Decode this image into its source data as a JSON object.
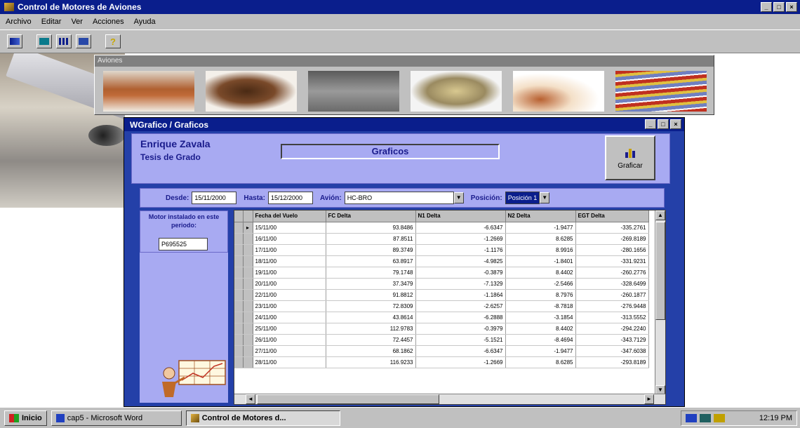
{
  "app": {
    "title": "Control de Motores de Aviones"
  },
  "menu": [
    "Archivo",
    "Editar",
    "Ver",
    "Acciones",
    "Ayuda"
  ],
  "aviones_panel": {
    "title": "Aviones"
  },
  "grafico_window": {
    "title": "WGrafico / Graficos",
    "author": "Enrique Zavala",
    "subtitle": "Tesis de Grado",
    "heading": "Graficos",
    "graficar_label": "Graficar"
  },
  "filters": {
    "desde_label": "Desde:",
    "desde_value": "15/11/2000",
    "hasta_label": "Hasta:",
    "hasta_value": "15/12/2000",
    "avion_label": "Avión:",
    "avion_value": "HC-BRO",
    "posicion_label": "Posición:",
    "posicion_value": "Posición 1"
  },
  "motor": {
    "label": "Motor instalado en este periodo:",
    "value": "P695525"
  },
  "table": {
    "columns": [
      "Fecha del Vuelo",
      "FC Delta",
      "N1 Delta",
      "N2 Delta",
      "EGT Delta"
    ],
    "rows": [
      [
        "15/11/00",
        "93.8486",
        "-6.6347",
        "-1.9477",
        "-335.2761"
      ],
      [
        "16/11/00",
        "87.8511",
        "-1.2669",
        "8.6285",
        "-269.8189"
      ],
      [
        "17/11/00",
        "89.3749",
        "-1.1176",
        "8.9916",
        "-280.1656"
      ],
      [
        "18/11/00",
        "63.8917",
        "-4.9825",
        "-1.8401",
        "-331.9231"
      ],
      [
        "19/11/00",
        "79.1748",
        "-0.3879",
        "8.4402",
        "-260.2776"
      ],
      [
        "20/11/00",
        "37.3479",
        "-7.1329",
        "-2.5466",
        "-328.6499"
      ],
      [
        "22/11/00",
        "91.8812",
        "-1.1864",
        "8.7976",
        "-260.1877"
      ],
      [
        "23/11/00",
        "72.8309",
        "-2.6257",
        "-8.7818",
        "-276.9448"
      ],
      [
        "24/11/00",
        "43.8614",
        "-6.2888",
        "-3.1854",
        "-313.5552"
      ],
      [
        "25/11/00",
        "112.9783",
        "-0.3979",
        "8.4402",
        "-294.2240"
      ],
      [
        "26/11/00",
        "72.4457",
        "-5.1521",
        "-8.4694",
        "-343.7129"
      ],
      [
        "27/11/00",
        "68.1862",
        "-6.6347",
        "-1.9477",
        "-347.6038"
      ],
      [
        "28/11/00",
        "116.9233",
        "-1.2669",
        "8.6285",
        "-293.8189"
      ]
    ]
  },
  "taskbar": {
    "start": "Inicio",
    "task1": "cap5 - Microsoft Word",
    "task2": "Control de Motores d...",
    "clock": "12:19 PM"
  },
  "icons": [
    "app-icon",
    "minimize-icon",
    "maximize-icon",
    "close-icon",
    "bar-chart-icon",
    "dropdown-arrow-icon",
    "help-icon"
  ]
}
